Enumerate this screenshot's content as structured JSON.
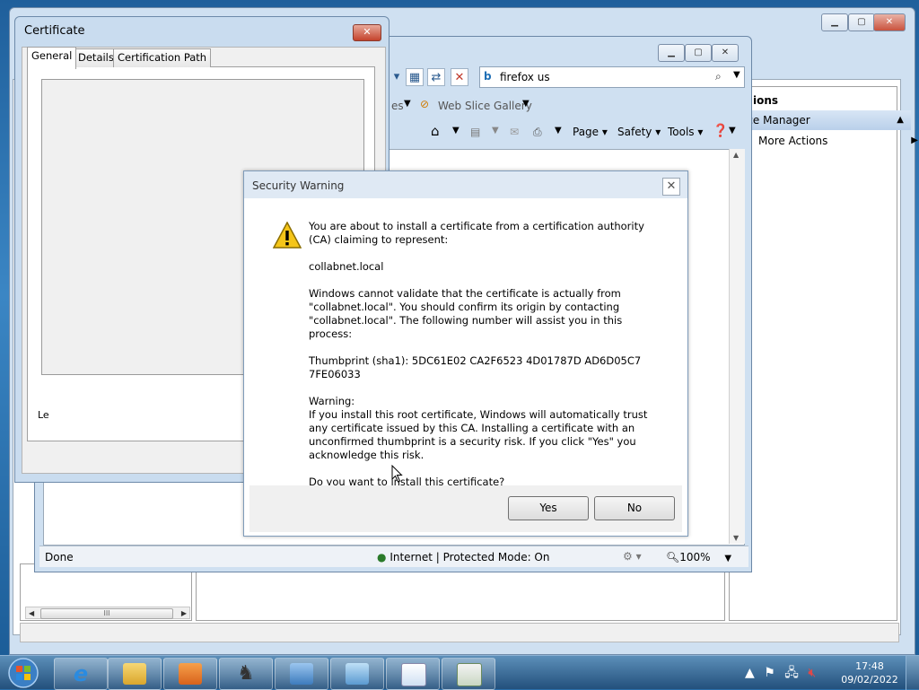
{
  "mmc": {
    "actions_header": "ions",
    "actions_selected": "ice Manager",
    "more_actions": "More Actions",
    "hscroll_thumb": "III"
  },
  "ie": {
    "search_value": "firefox us",
    "favorites_label": "es",
    "web_slice_gallery": "Web Slice Gallery",
    "menu_page": "Page",
    "menu_safety": "Safety",
    "menu_tools": "Tools",
    "status_done": "Done",
    "status_zone": "Internet | Protected Mode: On",
    "status_zoom": "100%"
  },
  "certificate": {
    "title": "Certificate",
    "tabs": [
      "General",
      "Details",
      "Certification Path"
    ],
    "clipped_text": "Le"
  },
  "security_warning": {
    "title": "Security Warning",
    "intro": "You are about to install a certificate from a certification authority (CA) claiming to represent:",
    "ca_name": "collabnet.local",
    "validate": "Windows cannot validate that the certificate is actually from \"collabnet.local\". You should confirm its origin by contacting \"collabnet.local\". The following number will assist you in this process:",
    "thumbprint": "Thumbprint (sha1): 5DC61E02 CA2F6523 4D01787D AD6D05C7 7FE06033",
    "warning_label": "Warning:",
    "warning_text": "If you install this root certificate, Windows will automatically trust any certificate issued by this CA. Installing a certificate with an unconfirmed thumbprint is a security risk. If you click \"Yes\" you acknowledge this risk.",
    "question": "Do you want to install this certificate?",
    "yes_label": "Yes",
    "no_label": "No"
  },
  "taskbar": {
    "time": "17:48",
    "date": "09/02/2022"
  }
}
